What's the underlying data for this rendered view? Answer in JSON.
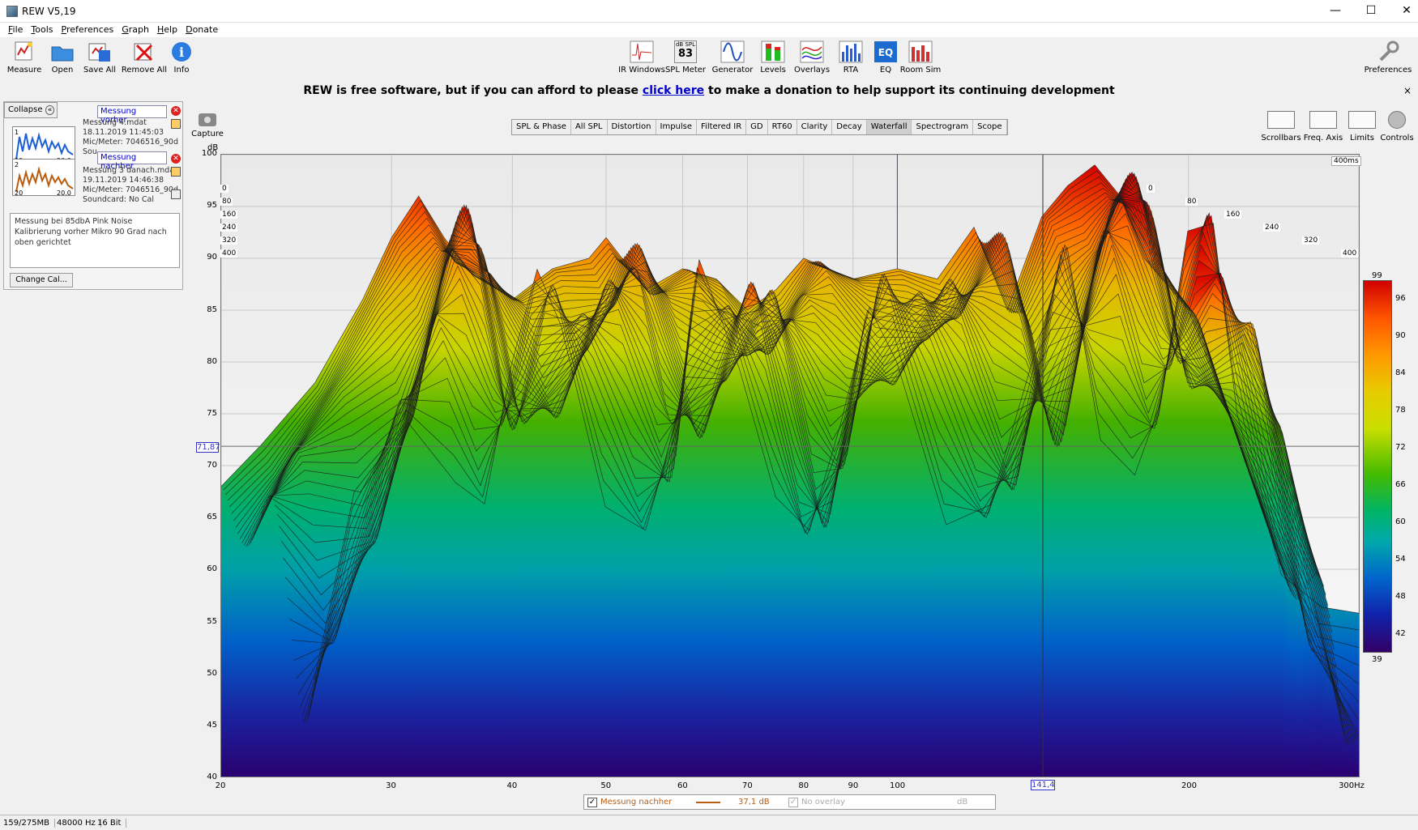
{
  "window": {
    "title": "REW V5,19",
    "minimize": "—",
    "maximize": "☐",
    "close": "✕"
  },
  "menu": [
    "File",
    "Tools",
    "Preferences",
    "Graph",
    "Help",
    "Donate"
  ],
  "toolbar": {
    "left": [
      {
        "label": "Measure",
        "icon": "measure-icon"
      },
      {
        "label": "Open",
        "icon": "folder-icon"
      },
      {
        "label": "Save All",
        "icon": "save-icon"
      },
      {
        "label": "Remove All",
        "icon": "remove-icon"
      },
      {
        "label": "Info",
        "icon": "info-icon"
      }
    ],
    "center": [
      {
        "label": "IR Windows",
        "icon": "ir-windows-icon"
      },
      {
        "label": "SPL Meter",
        "icon": "spl-meter-icon",
        "meter_unit": "dB SPL",
        "meter_value": "83"
      },
      {
        "label": "Generator",
        "icon": "generator-icon"
      },
      {
        "label": "Levels",
        "icon": "levels-icon"
      },
      {
        "label": "Overlays",
        "icon": "overlays-icon"
      },
      {
        "label": "RTA",
        "icon": "rta-icon"
      },
      {
        "label": "EQ",
        "icon": "eq-icon"
      },
      {
        "label": "Room Sim",
        "icon": "room-sim-icon"
      }
    ],
    "right": {
      "label": "Preferences",
      "icon": "wrench-icon"
    }
  },
  "donate": {
    "before": "REW is free software, but if you can afford to please ",
    "link": "click here",
    "after": " to make a donation to help support its continuing development",
    "close": "×"
  },
  "panel": {
    "collapse": "Collapse",
    "measurements": [
      {
        "name": "Messung vorher",
        "file": "Messung 4.mdat",
        "date": "18.11.2019 11:45:03",
        "mic": "Mic/Meter: 7046516_90d",
        "sound": "Sou",
        "thumb_color": "#1a5fd6",
        "index": "1"
      },
      {
        "name": "Messung nachher",
        "file": "Messung 3 danach.mdat",
        "date": "19.11.2019 14:46:38",
        "mic": "Mic/Meter: 7046516_90d",
        "sound": "Soundcard: No Cal",
        "thumb_color": "#b85c10",
        "index": "2"
      }
    ],
    "thumb_x_start": "20",
    "thumb_x_end": "20.0",
    "notes": "Messung bei 85dbA Pink Noise Kalibrierung vorher Mikro 90 Grad nach oben gerichtet",
    "change_cal": "Change Cal..."
  },
  "capture": "Capture",
  "tabs": [
    "SPL & Phase",
    "All SPL",
    "Distortion",
    "Impulse",
    "Filtered IR",
    "GD",
    "RT60",
    "Clarity",
    "Decay",
    "Waterfall",
    "Spectrogram",
    "Scope"
  ],
  "active_tab": "Waterfall",
  "right_tools": [
    {
      "label": "Scrollbars",
      "icon": "scrollbars-icon"
    },
    {
      "label": "Freq. Axis",
      "icon": "freq-axis-icon"
    },
    {
      "label": "Limits",
      "icon": "limits-icon"
    },
    {
      "label": "Controls",
      "icon": "gear-icon"
    }
  ],
  "chart_data": {
    "type": "area",
    "title": "",
    "ylabel": "dB",
    "xlabel": "",
    "x_scale": "log",
    "xlim": [
      20,
      300
    ],
    "ylim": [
      40,
      100
    ],
    "x_ticks": [
      "20",
      "30",
      "40",
      "50",
      "60",
      "70",
      "80",
      "90",
      "100",
      "200",
      "300Hz"
    ],
    "x_tick_values": [
      20,
      30,
      40,
      50,
      60,
      70,
      80,
      90,
      100,
      200,
      300
    ],
    "y_ticks": [
      "100",
      "95",
      "90",
      "85",
      "80",
      "75",
      "70",
      "65",
      "60",
      "55",
      "50",
      "45",
      "40"
    ],
    "time_labels": [
      "0",
      "80",
      "160",
      "240",
      "320",
      "400"
    ],
    "time_label_ms": "400ms",
    "cursor_y": "71,87",
    "cursor_x": "141,4",
    "colorbar": {
      "min": "39",
      "max": "99",
      "ticks": [
        "96",
        "90",
        "84",
        "78",
        "72",
        "66",
        "60",
        "54",
        "48",
        "42"
      ]
    },
    "series": [
      {
        "name": "Messung nachher",
        "x": [
          20,
          22,
          25,
          28,
          30,
          32,
          34,
          36,
          40,
          44,
          48,
          50,
          55,
          60,
          65,
          70,
          75,
          80,
          90,
          100,
          110,
          120,
          130,
          141,
          150,
          160,
          170,
          180,
          200,
          220,
          250
        ],
        "y": [
          68,
          72,
          78,
          86,
          92,
          96,
          92,
          89,
          86,
          89,
          90,
          92,
          87,
          89,
          88,
          85,
          87,
          90,
          88,
          89,
          88,
          93,
          85,
          94,
          97,
          99,
          96,
          90,
          85,
          75,
          60
        ]
      }
    ],
    "grid": true,
    "legend_position": "bottom"
  },
  "legend": {
    "series1": "Messung nachher",
    "series1_value": "37,1 dB",
    "series1_color": "#b85c10",
    "series2": "No overlay",
    "series2_unit": "dB"
  },
  "status": {
    "memory": "159/275MB",
    "rate": "48000 Hz",
    "bits": "16 Bit"
  }
}
